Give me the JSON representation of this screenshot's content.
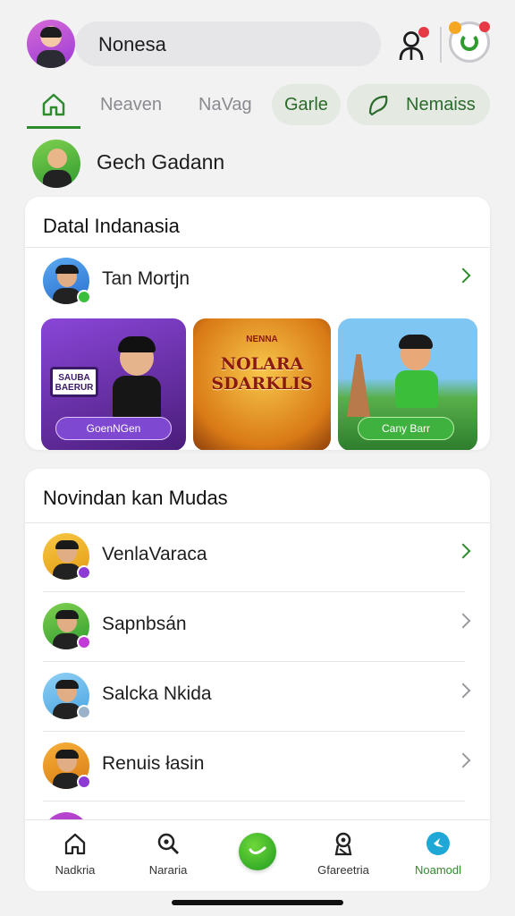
{
  "header": {
    "search_text": "Nonesa",
    "colors": {
      "accent_green": "#2e8b2e",
      "notification_red": "#e63946"
    }
  },
  "tabs": [
    {
      "label": "",
      "icon": "home-icon",
      "active": true
    },
    {
      "label": "Neaven"
    },
    {
      "label": "NaVag"
    },
    {
      "label": "Garle"
    },
    {
      "label": "Nemaiss",
      "icon": "leaf-chat-icon"
    }
  ],
  "featured": {
    "name": "Gech Gadann"
  },
  "section1": {
    "title": "Datal Indanasia",
    "user": {
      "name": "Tan Mortjn"
    },
    "games": [
      {
        "sign": "SAUBA BAERUR",
        "button": "GoenNGen"
      },
      {
        "subtitle": "NENNA",
        "title": "NOLARA SDARKLIS"
      },
      {
        "button": "Cany Barr"
      }
    ]
  },
  "section2": {
    "title": "Novindan kan Mudas",
    "items": [
      {
        "name": "VenlaVaraca"
      },
      {
        "name": "Sapnbsán"
      },
      {
        "name": "Salcka Nkida"
      },
      {
        "name": "Renuis łasin"
      }
    ]
  },
  "bottom_nav": [
    {
      "label": "Nadkria",
      "icon": "home-icon"
    },
    {
      "label": "Nararia",
      "icon": "search-icon"
    },
    {
      "label": "",
      "icon": "chat-bubble-icon"
    },
    {
      "label": "Gfareetria",
      "icon": "location-pin-icon"
    },
    {
      "label": "Noamodl",
      "icon": "bird-icon",
      "active": true
    }
  ]
}
